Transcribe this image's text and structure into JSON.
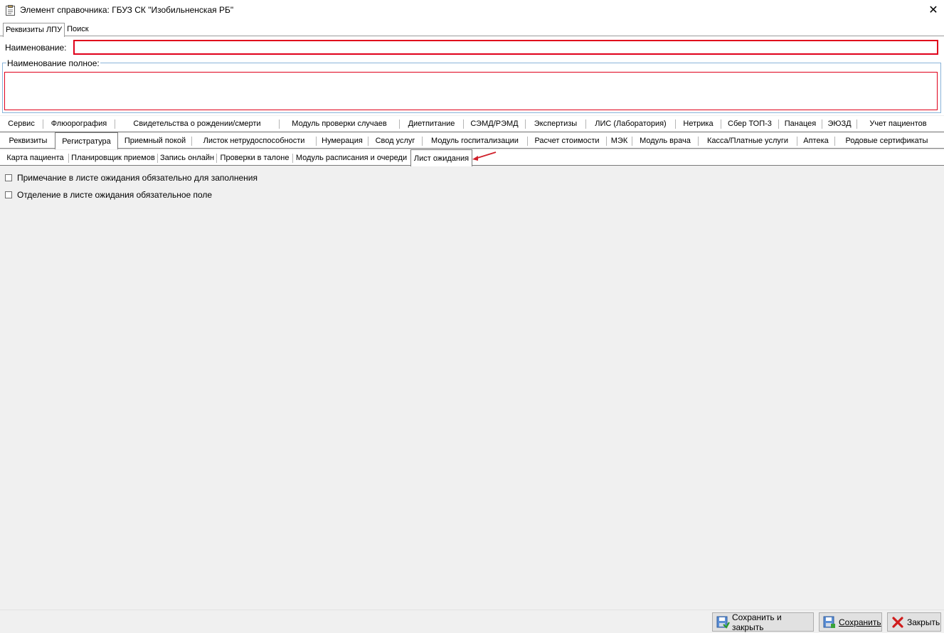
{
  "window": {
    "title": "Элемент справочника: ГБУЗ СК \"Изобильненская РБ\"",
    "close_label": "✕"
  },
  "top_tabs": [
    {
      "label": "Реквизиты ЛПУ",
      "active": true
    },
    {
      "label": "Поиск",
      "active": false
    }
  ],
  "form": {
    "name_label": "Наименование:",
    "name_value": "",
    "full_name_label": "Наименование полное:",
    "full_name_value": ""
  },
  "module_tabs_row1": [
    "Сервис",
    "Флюорография",
    "Свидетельства о рождении/смерти",
    "Модуль проверки случаев",
    "Диетпитание",
    "СЭМД/РЭМД",
    "Экспертизы",
    "ЛИС (Лаборатория)",
    "Нетрика",
    "Сбер ТОП-3",
    "Панацея",
    "ЭЮЗД",
    "Учет пациентов"
  ],
  "module_tabs_row2": [
    "Реквизиты",
    "Регистратура",
    "Приемный покой",
    "Листок нетрудоспособности",
    "Нумерация",
    "Свод услуг",
    "Модуль госпитализации",
    "Расчет стоимости",
    "МЭК",
    "Модуль врача",
    "Касса/Платные услуги",
    "Аптека",
    "Родовые сертификаты"
  ],
  "active_row2": "Регистратура",
  "sub_tabs": [
    "Карта пациента",
    "Планировщик приемов",
    "Запись онлайн",
    "Проверки в талоне",
    "Модуль расписания и очереди",
    "Лист ожидания"
  ],
  "active_sub_tab": "Лист ожидания",
  "options": [
    {
      "label": "Примечание в листе ожидания обязательно для заполнения",
      "checked": false
    },
    {
      "label": "Отделение в листе ожидания обязательное поле",
      "checked": false
    }
  ],
  "buttons": {
    "save_close": "Сохранить и закрыть",
    "save": "Сохранить",
    "close": "Закрыть"
  },
  "colors": {
    "required_border": "#e0001b",
    "group_border": "#8ab4d9",
    "annotation_arrow": "#d0202a",
    "background": "#f0f0f0"
  }
}
